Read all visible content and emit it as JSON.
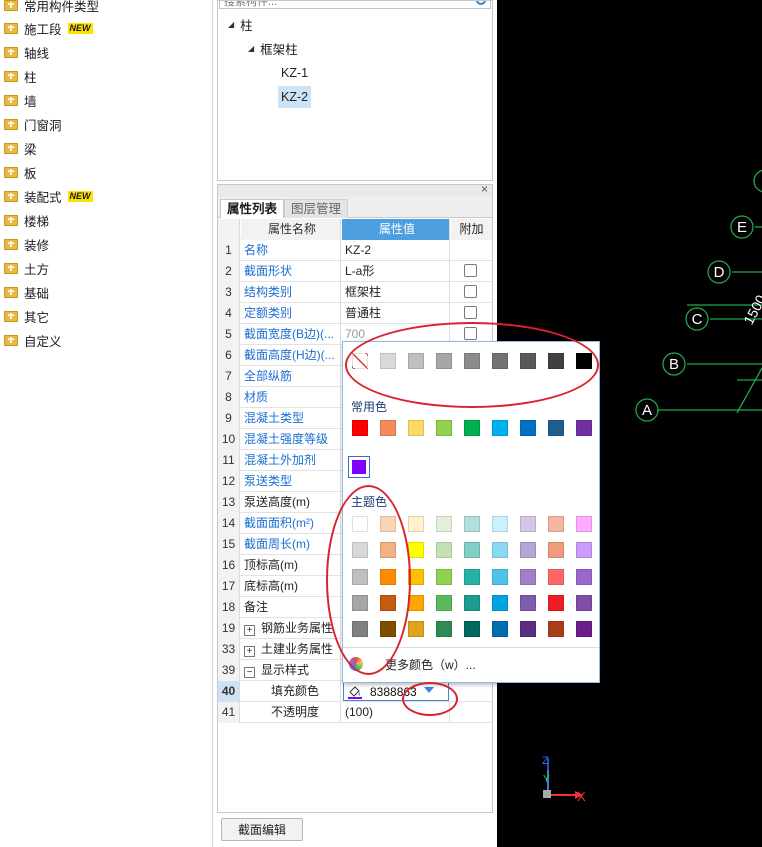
{
  "sidebar": {
    "items": [
      {
        "label": "常用构件类型",
        "badge": ""
      },
      {
        "label": "施工段",
        "badge": "NEW"
      },
      {
        "label": "轴线",
        "badge": ""
      },
      {
        "label": "柱",
        "badge": ""
      },
      {
        "label": "墙",
        "badge": ""
      },
      {
        "label": "门窗洞",
        "badge": ""
      },
      {
        "label": "梁",
        "badge": ""
      },
      {
        "label": "板",
        "badge": ""
      },
      {
        "label": "装配式",
        "badge": "NEW"
      },
      {
        "label": "楼梯",
        "badge": ""
      },
      {
        "label": "装修",
        "badge": ""
      },
      {
        "label": "土方",
        "badge": ""
      },
      {
        "label": "基础",
        "badge": ""
      },
      {
        "label": "其它",
        "badge": ""
      },
      {
        "label": "自定义",
        "badge": ""
      }
    ]
  },
  "component_tree": {
    "search_placeholder": "搜索构件...",
    "root": "柱",
    "group": "框架柱",
    "items": [
      "KZ-1",
      "KZ-2"
    ],
    "selected": "KZ-2"
  },
  "properties": {
    "close": "×",
    "tabs": [
      "属性列表",
      "图层管理"
    ],
    "active_tab": "属性列表",
    "headers": {
      "name": "属性名称",
      "value": "属性值",
      "extra": "附加"
    },
    "rows": [
      {
        "idx": "1",
        "name": "名称",
        "value": "KZ-2",
        "blue": true,
        "check": false
      },
      {
        "idx": "2",
        "name": "截面形状",
        "value": "L-a形",
        "blue": true,
        "check": true
      },
      {
        "idx": "3",
        "name": "结构类别",
        "value": "框架柱",
        "blue": true,
        "check": true
      },
      {
        "idx": "4",
        "name": "定额类别",
        "value": "普通柱",
        "blue": true,
        "check": true
      },
      {
        "idx": "5",
        "name": "截面宽度(B边)(...",
        "value": "700",
        "blue": true,
        "check": true,
        "grey": true
      },
      {
        "idx": "6",
        "name": "截面高度(H边)(...",
        "value": "",
        "blue": true,
        "check": false
      },
      {
        "idx": "7",
        "name": "全部纵筋",
        "value": "",
        "blue": true,
        "check": false
      },
      {
        "idx": "8",
        "name": "材质",
        "value": "",
        "blue": true,
        "check": false
      },
      {
        "idx": "9",
        "name": "混凝土类型",
        "value": "",
        "blue": true,
        "check": false
      },
      {
        "idx": "10",
        "name": "混凝土强度等级",
        "value": "",
        "blue": true,
        "check": false
      },
      {
        "idx": "11",
        "name": "混凝土外加剂",
        "value": "",
        "blue": true,
        "check": false
      },
      {
        "idx": "12",
        "name": "泵送类型",
        "value": "",
        "blue": true,
        "check": false
      },
      {
        "idx": "13",
        "name": "泵送高度(m)",
        "value": "",
        "blue": false,
        "check": false
      },
      {
        "idx": "14",
        "name": "截面面积(m²)",
        "value": "",
        "blue": true,
        "check": false
      },
      {
        "idx": "15",
        "name": "截面周长(m)",
        "value": "",
        "blue": true,
        "check": false
      },
      {
        "idx": "16",
        "name": "顶标高(m)",
        "value": "",
        "blue": false,
        "check": false
      },
      {
        "idx": "17",
        "name": "底标高(m)",
        "value": "",
        "blue": false,
        "check": false
      },
      {
        "idx": "18",
        "name": "备注",
        "value": "",
        "blue": false,
        "check": false
      },
      {
        "idx": "19",
        "name": "钢筋业务属性",
        "value": "",
        "blue": false,
        "check": false,
        "expander": "+"
      },
      {
        "idx": "33",
        "name": "土建业务属性",
        "value": "",
        "blue": false,
        "check": false,
        "expander": "+"
      },
      {
        "idx": "39",
        "name": "显示样式",
        "value": "",
        "blue": false,
        "check": false,
        "expander": "−"
      },
      {
        "idx": "40",
        "name": "填充颜色",
        "value": "",
        "blue": false,
        "check": false,
        "indent": true,
        "selected": true
      },
      {
        "idx": "41",
        "name": "不透明度",
        "value": "(100)",
        "blue": false,
        "check": false,
        "indent": true
      }
    ],
    "fill_color_value": "8388863",
    "section_edit_button": "截面编辑"
  },
  "color_picker": {
    "gray_row": [
      "#ffffff",
      "#d9d9d9",
      "#bfbfbf",
      "#a6a6a6",
      "#8c8c8c",
      "#737373",
      "#595959",
      "#404040",
      "#000000"
    ],
    "common_label": "常用色",
    "common_colors": [
      "#ff0000",
      "#f58a5a",
      "#ffd966",
      "#92d050",
      "#00b050",
      "#00b0f0",
      "#0070c0",
      "#1f5f8b",
      "#7030a0"
    ],
    "recent_color": "#8000ff",
    "theme_label": "主题色",
    "theme_colors": [
      [
        "#ffffff",
        "#fbd5b5",
        "#fff2cc",
        "#e2f0d9",
        "#b2dfdb",
        "#c9f1ff",
        "#d5c4e8",
        "#f8b4a2",
        "#ffaaff"
      ],
      [
        "#d9d9d9",
        "#f4b183",
        "#ffff00",
        "#c5e0b4",
        "#80d0c7",
        "#8ad9f4",
        "#b4a7d6",
        "#f19b7d",
        "#cc99ff"
      ],
      [
        "#bfbfbf",
        "#ff8c00",
        "#ffc000",
        "#92d050",
        "#26b3a4",
        "#4fc3e8",
        "#9f7fc8",
        "#ff6666",
        "#9966cc"
      ],
      [
        "#a6a6a6",
        "#c55a11",
        "#ffa500",
        "#5cb85c",
        "#1b9e8f",
        "#00a3e0",
        "#7d5bb0",
        "#ee1c25",
        "#7f4fa8"
      ],
      [
        "#808080",
        "#7f4f00",
        "#e3a21a",
        "#2e8b57",
        "#00695c",
        "#006fb0",
        "#5b2c83",
        "#a93e1b",
        "#6a1f8a"
      ]
    ],
    "more_colors": "更多颜色（w）..."
  },
  "canvas": {
    "axis_labels": [
      "E",
      "D",
      "C",
      "B",
      "A"
    ],
    "dimension_text": "1500",
    "axis_x": "X",
    "axis_y": "Y",
    "axis_z": "Z"
  }
}
